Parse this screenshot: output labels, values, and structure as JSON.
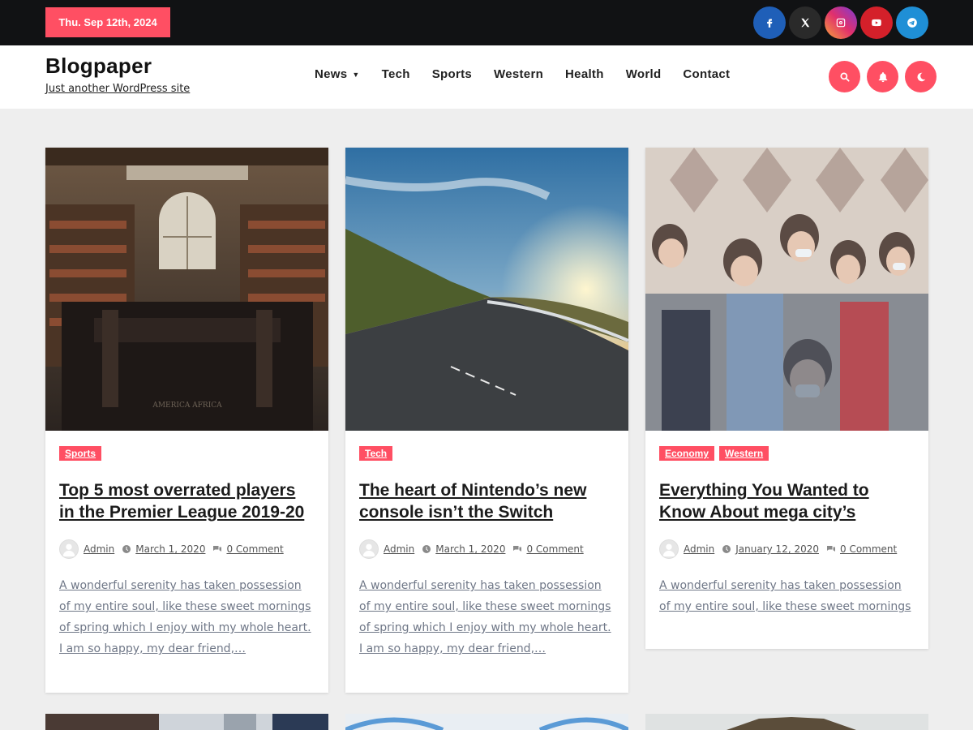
{
  "topbar": {
    "date": "Thu. Sep 12th, 2024",
    "socials": [
      {
        "name": "facebook-icon",
        "color": "#1f5fb8"
      },
      {
        "name": "x-icon",
        "color": "#2a2a2a"
      },
      {
        "name": "instagram-icon",
        "color": "#d62f8b"
      },
      {
        "name": "youtube-icon",
        "color": "#d4202a"
      },
      {
        "name": "telegram-icon",
        "color": "#1f8fd6"
      }
    ]
  },
  "header": {
    "site_title": "Blogpaper",
    "tagline": "Just another WordPress site",
    "nav": [
      "News",
      "Tech",
      "Sports",
      "Western",
      "Health",
      "World",
      "Contact"
    ],
    "actions": [
      "search-icon",
      "bell-icon",
      "moon-icon"
    ],
    "accent": "#ff4f63"
  },
  "posts": [
    {
      "categories": [
        "Sports"
      ],
      "title": "Top 5 most overrated players in the Premier League 2019-20",
      "author": "Admin",
      "date": "March 1, 2020",
      "comments": "0 Comment",
      "excerpt": "A wonderful serenity has taken possession of my entire soul, like these sweet mornings of spring which I enjoy with my whole heart. I am so happy, my dear friend,…",
      "image": "library-photo"
    },
    {
      "categories": [
        "Tech"
      ],
      "title": "The heart of Nintendo’s new console isn’t the Switch",
      "author": "Admin",
      "date": "March 1, 2020",
      "comments": "0 Comment",
      "excerpt": "A wonderful serenity has taken possession of my entire soul, like these sweet mornings of spring which I enjoy with my whole heart. I am so happy, my dear friend,…",
      "image": "sunset-road-photo"
    },
    {
      "categories": [
        "Economy",
        "Western"
      ],
      "title": "Everything You Wanted to Know About mega city’s",
      "author": "Admin",
      "date": "January 12, 2020",
      "comments": "0 Comment",
      "excerpt": "A wonderful serenity has taken possession of my entire soul, like these sweet mornings",
      "image": "crowd-masks-photo"
    }
  ]
}
